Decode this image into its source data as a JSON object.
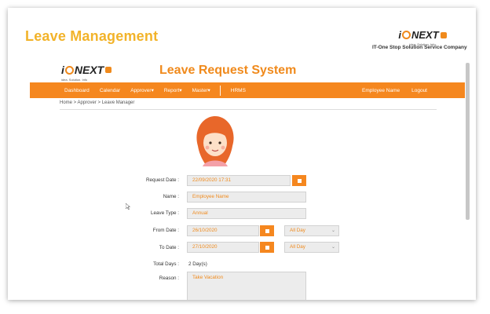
{
  "slide": {
    "title": "Leave Management",
    "logo_text_1": "i",
    "logo_text_2": "NEXT",
    "logo_tagline": "idea. Solution. Info",
    "company": "IT-One Stop Solution Service Company"
  },
  "app": {
    "logo_text_1": "i",
    "logo_text_2": "NEXT",
    "logo_tagline": "idea. Solution. Info",
    "title": "Leave Request System",
    "accent_color": "#f5871f"
  },
  "nav": {
    "items": [
      {
        "label": "Dashboard"
      },
      {
        "label": "Calendar"
      },
      {
        "label": "Approver▾"
      },
      {
        "label": "Report▾"
      },
      {
        "label": "Master▾"
      },
      {
        "label": "HRMS"
      }
    ],
    "right": [
      {
        "label": "Employee Name"
      },
      {
        "label": "Logout"
      }
    ]
  },
  "breadcrumb": "Home > Approver > Leave Manager",
  "form": {
    "request_date_label": "Request Date :",
    "request_date_value": "22/09/2020 17:31",
    "name_label": "Name :",
    "name_placeholder": "Employee Name",
    "leave_type_label": "Leave Type :",
    "leave_type_value": "Annual",
    "from_date_label": "From Date :",
    "from_date_value": "26/10/2020",
    "from_period": "All Day",
    "to_date_label": "To Date :",
    "to_date_value": "27/10/2020",
    "to_period": "All Day",
    "total_days_label": "Total Days :",
    "total_days_value": "2 Day(s)",
    "reason_label": "Reason :",
    "reason_value": "Take Vacation"
  }
}
